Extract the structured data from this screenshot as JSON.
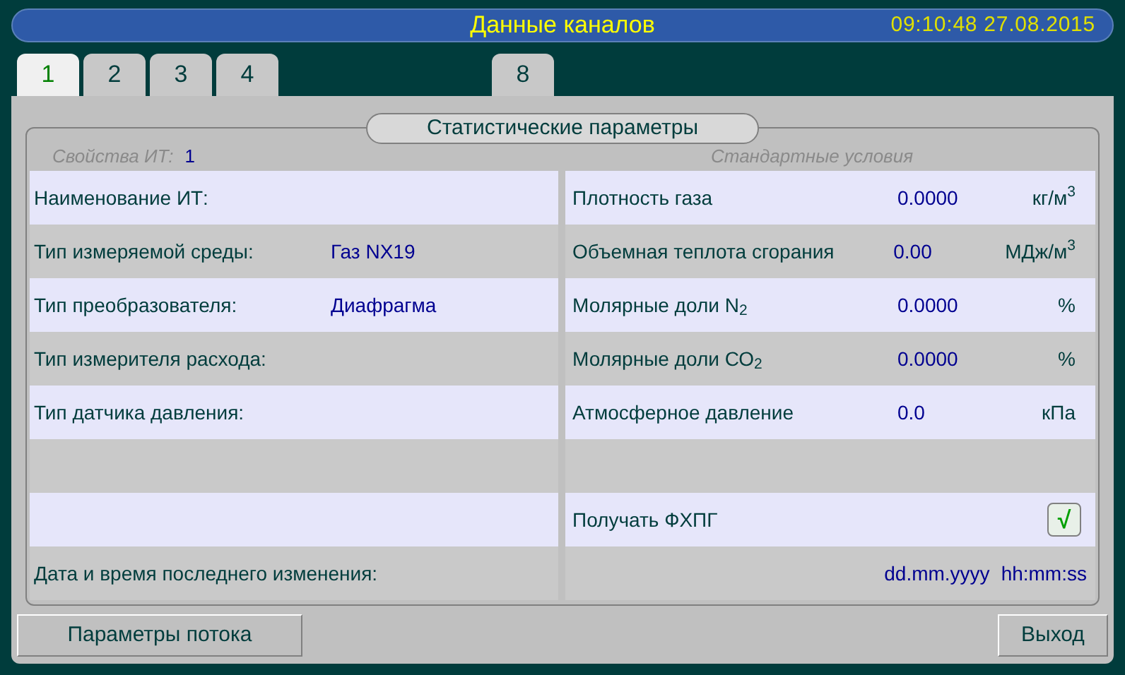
{
  "header": {
    "title": "Данные каналов",
    "datetime": "09:10:48  27.08.2015"
  },
  "tabs": [
    {
      "label": "1",
      "selected": true,
      "offset": false
    },
    {
      "label": "2",
      "selected": false,
      "offset": false
    },
    {
      "label": "3",
      "selected": false,
      "offset": false
    },
    {
      "label": "4",
      "selected": false,
      "offset": false
    },
    {
      "label": "8",
      "selected": false,
      "offset": true
    }
  ],
  "group_title": "Статистические параметры",
  "left_caption": {
    "label": "Свойства ИТ:",
    "value": "1"
  },
  "right_caption": "Стандартные условия",
  "left_rows": [
    {
      "label": "Наименование ИТ:"
    },
    {
      "label": "Тип измеряемой среды:",
      "value": "Газ NX19"
    },
    {
      "label": "Тип преобразователя:",
      "value": "Диафрагма"
    },
    {
      "label": "Тип измерителя расхода:"
    },
    {
      "label": "Тип датчика давления:"
    },
    {},
    {},
    {
      "label": "Дата и время последнего изменения:"
    }
  ],
  "right_rows": [
    {
      "kind": "param",
      "label": "Плотность газа",
      "value": "0.0000",
      "unit": "кг/м$^{3}$"
    },
    {
      "kind": "param",
      "label": "Объемная теплота сгорания",
      "value": "0.00",
      "unit": "МДж/м$^{3}$"
    },
    {
      "kind": "param",
      "label": "Молярные доли N$_{2}$",
      "value": "0.0000",
      "unit": "%"
    },
    {
      "kind": "param",
      "label": "Молярные доли СО$_{2}$",
      "value": "0.0000",
      "unit": "%"
    },
    {
      "kind": "param",
      "label": "Атмосферное давление",
      "value": "0.0",
      "unit": "кПа"
    },
    {
      "kind": "empty"
    },
    {
      "kind": "checkbox",
      "label": "Получать ФХПГ",
      "checked": true,
      "mark": "√"
    },
    {
      "kind": "datetime",
      "date": "dd.mm.yyyy",
      "time": "hh:mm:ss"
    }
  ],
  "buttons": {
    "left": "Параметры потока",
    "right": "Выход"
  }
}
